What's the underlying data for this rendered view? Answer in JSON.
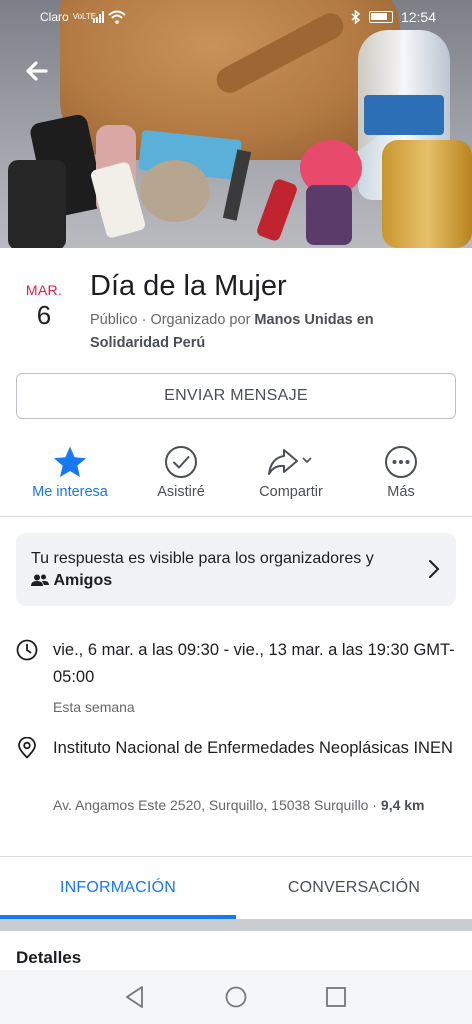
{
  "status_bar": {
    "carrier": "Claro",
    "network": "VoLTE",
    "time": "12:54"
  },
  "event": {
    "month": "MAR.",
    "day": "6",
    "title": "Día de la Mujer",
    "meta_prefix": "Público · Organizado por ",
    "organizer": "Manos Unidas en Solidaridad Perú"
  },
  "send_message_label": "ENVIAR MENSAJE",
  "actions": [
    {
      "label": "Me interesa",
      "icon": "star-icon",
      "active": true
    },
    {
      "label": "Asistiré",
      "icon": "check-circle-icon",
      "active": false
    },
    {
      "label": "Compartir",
      "icon": "share-icon",
      "active": false
    },
    {
      "label": "Más",
      "icon": "more-icon",
      "active": false
    }
  ],
  "visibility": {
    "text_prefix": "Tu respuesta es visible para los organizadores y",
    "audience": "Amigos"
  },
  "details": {
    "datetime": "vie., 6 mar. a las 09:30 - vie., 13 mar. a las 19:30 GMT-05:00",
    "datetime_sub": "Esta semana",
    "location": "Instituto Nacional de Enfermedades Neoplásicas INEN",
    "address": "Av. Angamos Este 2520, Surquillo, 15038 Surquillo · ",
    "distance": "9,4 km"
  },
  "tabs": [
    {
      "label": "INFORMACIÓN",
      "active": true
    },
    {
      "label": "CONVERSACIÓN",
      "active": false
    }
  ],
  "section_title": "Detalles",
  "colors": {
    "accent": "#1877f2",
    "date_red": "#e41e3f"
  }
}
